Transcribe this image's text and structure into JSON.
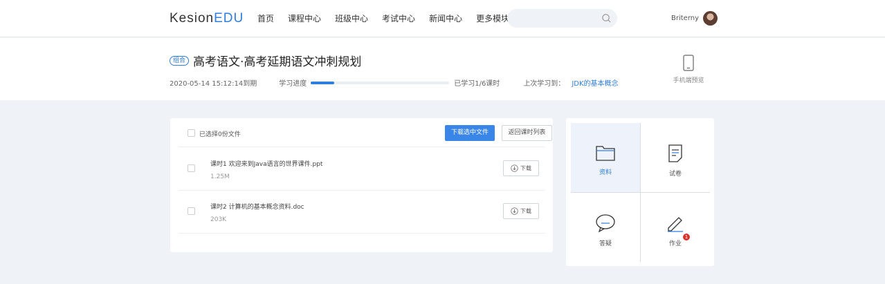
{
  "header": {
    "logo_main": "Kesion",
    "logo_accent": "EDU",
    "nav": [
      "首页",
      "课程中心",
      "班级中心",
      "考试中心",
      "新闻中心",
      "更多模块"
    ],
    "search_placeholder": "",
    "user_name": "Briterny"
  },
  "course": {
    "badge": "组合",
    "title": "高考语文·高考延期语文冲刺规划",
    "expiry": "2020-05-14 15:12:14到期",
    "progress_label": "学习进度",
    "progress_value": 0.167,
    "learned": "已学习1/6课时",
    "last_label": "上次学习到：",
    "last_link": "JDK的基本概念",
    "mobile_preview": "手机端预览"
  },
  "files": {
    "selected_text": "已选择0份文件",
    "download_selected": "下载选中文件",
    "back_to_list": "返回课时列表",
    "download_label": "下载",
    "items": [
      {
        "name": "课时1   欢迎来到Java语言的世界课件.ppt",
        "size": "1.25M"
      },
      {
        "name": "课时2   计算机的基本概念资料.doc",
        "size": "203K"
      }
    ]
  },
  "side": {
    "materials": "资料",
    "papers": "试卷",
    "qa": "答疑",
    "homework": "作业",
    "homework_badge": "1"
  },
  "colors": {
    "accent": "#2f7ddc",
    "badge_red": "#d9312b"
  }
}
